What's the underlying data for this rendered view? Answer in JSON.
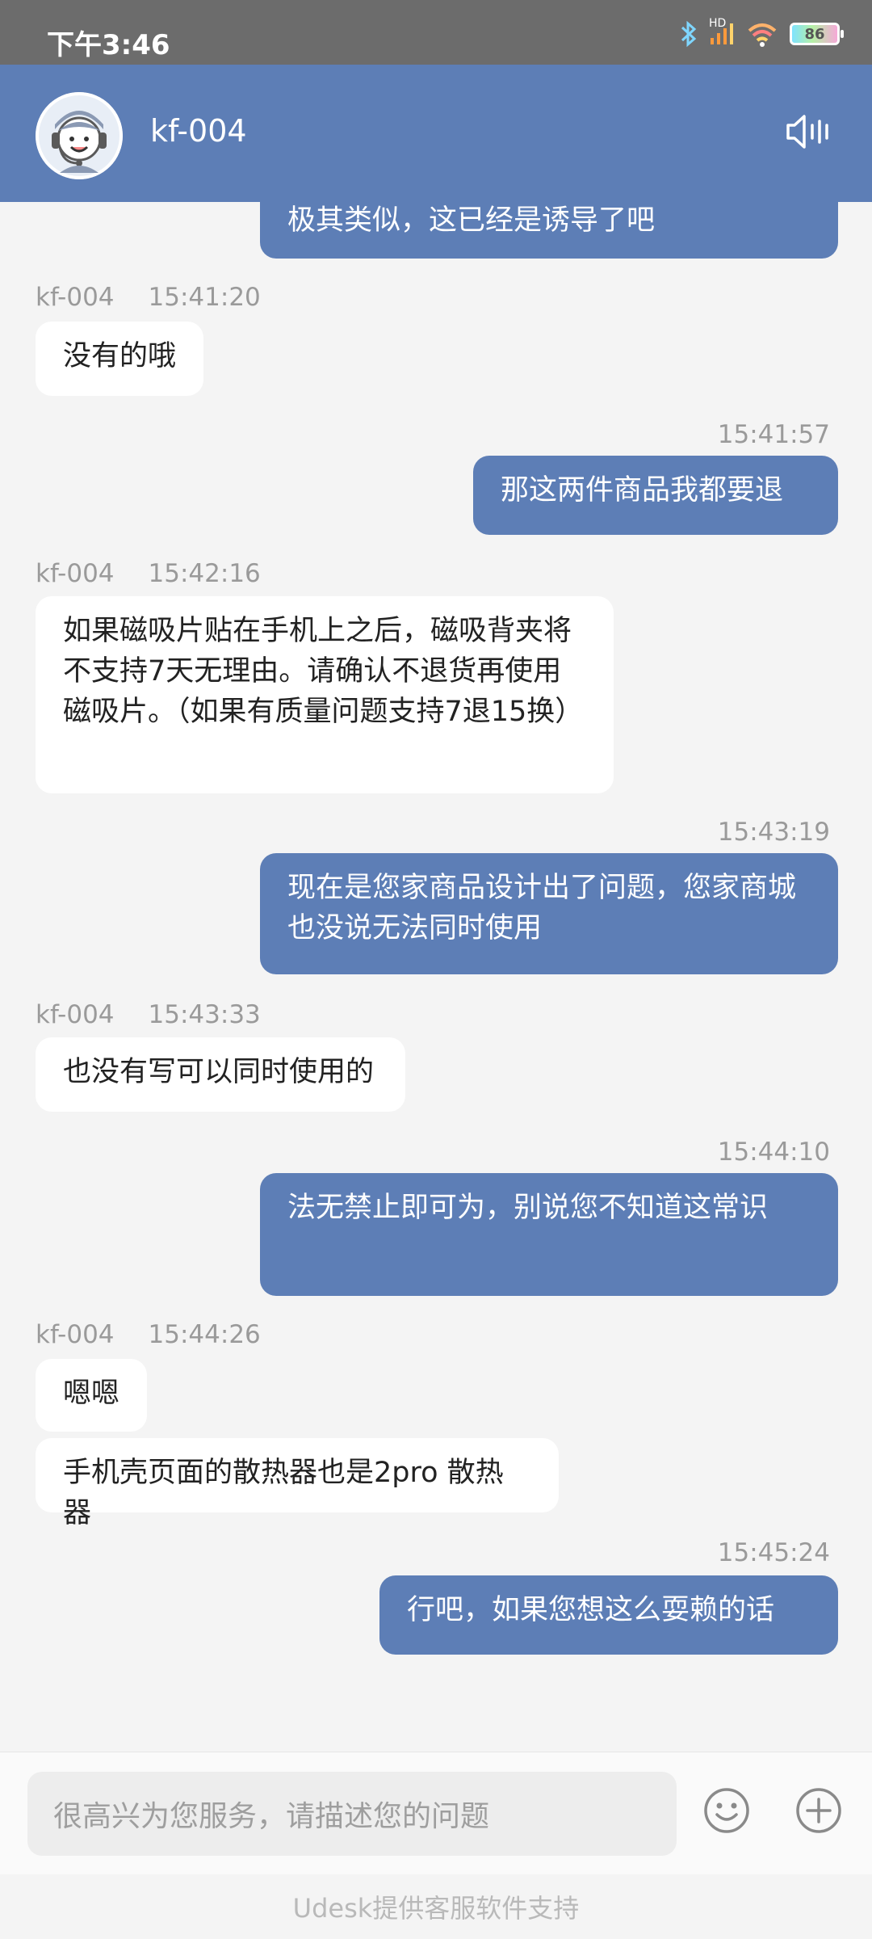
{
  "status_bar": {
    "time": "下午3:46",
    "network_label": "HD",
    "battery": "86"
  },
  "header": {
    "agent_name": "kf-004"
  },
  "messages": [
    {
      "role": "me",
      "text": "极其类似，这已经是诱导了吧"
    },
    {
      "role": "them",
      "sender": "kf-004",
      "time": "15:41:20",
      "text": "没有的哦"
    },
    {
      "role": "me",
      "time": "15:41:57",
      "text": "那这两件商品我都要退"
    },
    {
      "role": "them",
      "sender": "kf-004",
      "time": "15:42:16",
      "text": "如果磁吸片贴在手机上之后，磁吸背夹将不支持7天无理由。请确认不退货再使用磁吸片。（如果有质量问题支持7退15换）"
    },
    {
      "role": "me",
      "time": "15:43:19",
      "text": "现在是您家商品设计出了问题，您家商城也没说无法同时使用"
    },
    {
      "role": "them",
      "sender": "kf-004",
      "time": "15:43:33",
      "text": "也没有写可以同时使用的"
    },
    {
      "role": "me",
      "time": "15:44:10",
      "text": "法无禁止即可为，别说您不知道这常识"
    },
    {
      "role": "them",
      "sender": "kf-004",
      "time": "15:44:26",
      "text": "嗯嗯"
    },
    {
      "role": "them",
      "text": "手机壳页面的散热器也是2pro 散热器"
    },
    {
      "role": "me",
      "time": "15:45:24",
      "text": "行吧，如果您想这么耍赖的话"
    }
  ],
  "input": {
    "placeholder": "很高兴为您服务，请描述您的问题"
  },
  "footer": {
    "text": "Udesk提供客服软件支持"
  },
  "colors": {
    "header": "#5d7eb6",
    "my_bubble": "#5d7eb6",
    "their_bubble": "#ffffff",
    "background": "#f4f4f4"
  },
  "icons": [
    "bluetooth-icon",
    "signal-icon",
    "wifi-icon",
    "battery-icon",
    "agent-avatar",
    "speaker-icon",
    "emoji-icon",
    "plus-icon"
  ]
}
